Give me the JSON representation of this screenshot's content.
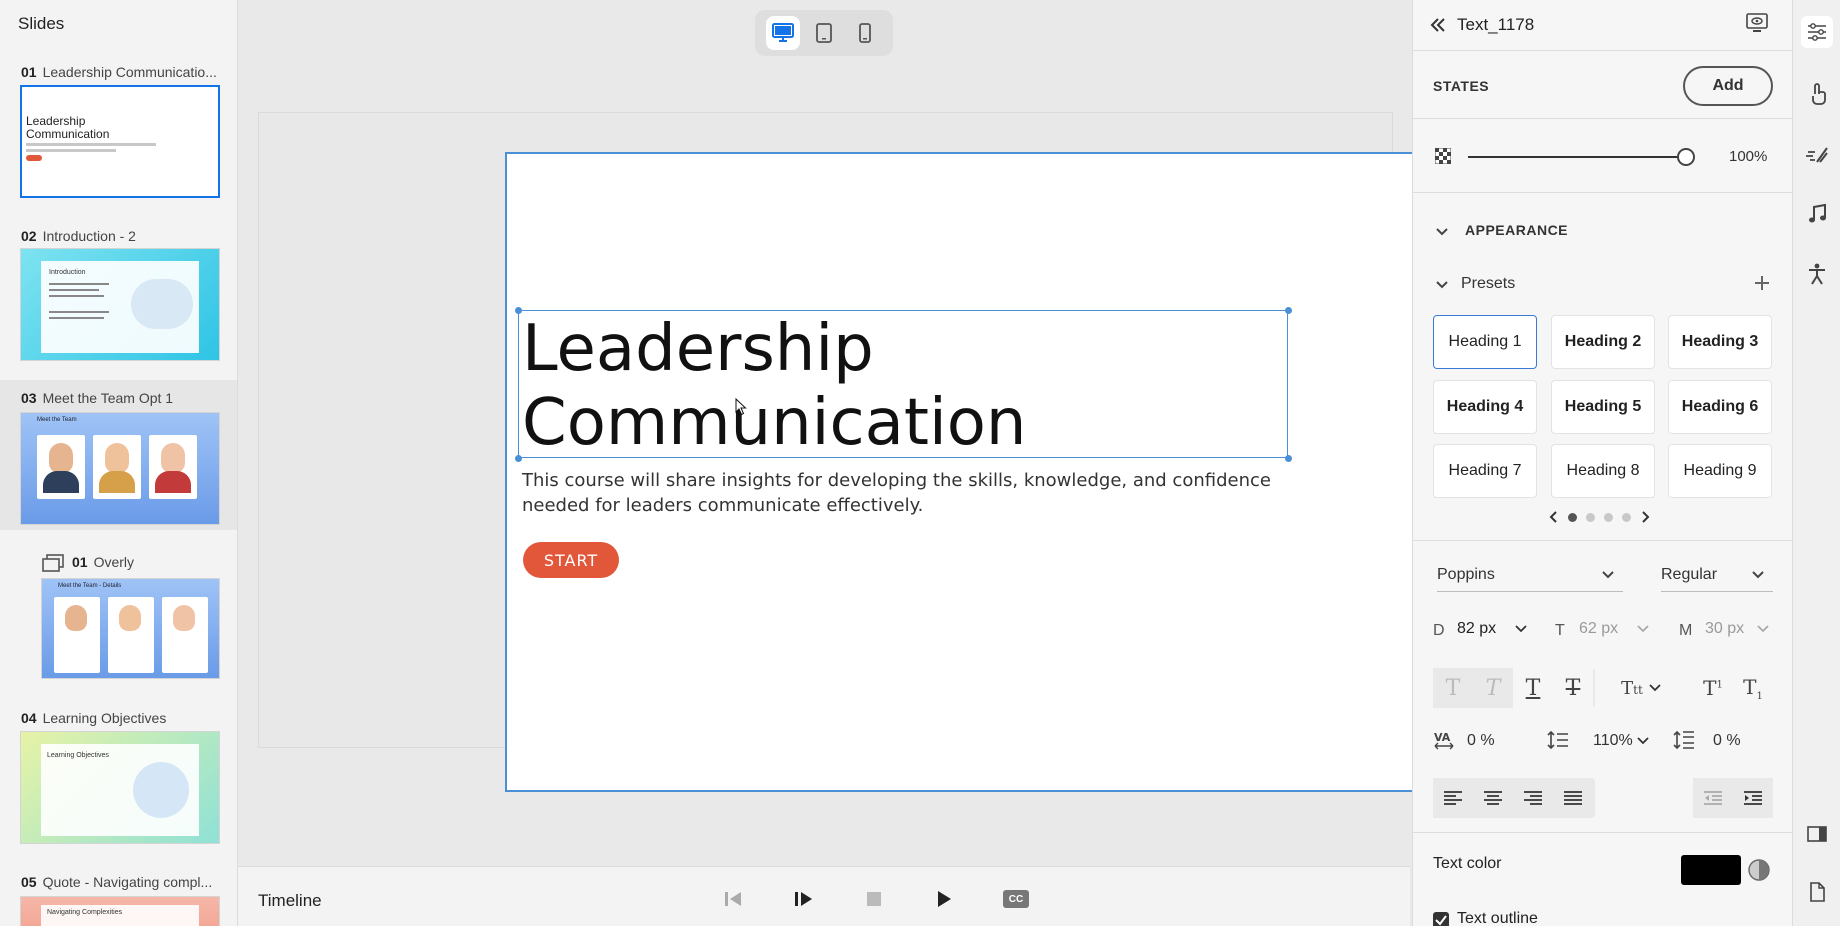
{
  "slides_panel": {
    "title": "Slides",
    "slides": [
      {
        "num": "01",
        "title": "Leadership Communicatio...",
        "thumb_title": "Leadership Communication"
      },
      {
        "num": "02",
        "title": "Introduction - 2",
        "thumb_title": "Introduction"
      },
      {
        "num": "03",
        "title": "Meet the Team Opt 1",
        "thumb_title": "Meet the Team"
      },
      {
        "num": "01",
        "title": "Overly",
        "thumb_title": "Meet the Team - Details"
      },
      {
        "num": "04",
        "title": "Learning Objectives",
        "thumb_title": "Learning Objectives"
      },
      {
        "num": "05",
        "title": "Quote - Navigating compl...",
        "thumb_title": "Navigating Complexities"
      }
    ]
  },
  "device_toggle": {
    "icons": [
      "desktop-icon",
      "tablet-icon",
      "mobile-icon"
    ],
    "active": "desktop"
  },
  "slide": {
    "title": "Leadership\nCommunication",
    "title_line1": "Leadership",
    "title_line2": "Communication",
    "description": "This course will share insights for developing the skills, knowledge, and confidence needed for leaders communicate effectively.",
    "start_label": "START",
    "accent": "#e2573a"
  },
  "timeline": {
    "label": "Timeline",
    "controls": [
      "prev-icon",
      "step-play-icon",
      "stop-icon",
      "play-icon",
      "cc-icon"
    ],
    "cc_label": "CC"
  },
  "properties": {
    "object_name": "Text_1178",
    "states_label": "STATES",
    "add_label": "Add",
    "opacity": "100%",
    "opacity_level": 1.0,
    "appearance_label": "APPEARANCE",
    "presets_label": "Presets",
    "presets": [
      "Heading 1",
      "Heading 2",
      "Heading 3",
      "Heading 4",
      "Heading 5",
      "Heading 6",
      "Heading 7",
      "Heading 8",
      "Heading 9"
    ],
    "font_family": "Poppins",
    "font_weight": "Regular",
    "size_desktop_label": "D",
    "size_desktop": "82 px",
    "size_tablet_label": "T",
    "size_tablet": "62 px",
    "size_mobile_label": "M",
    "size_mobile": "30 px",
    "letter_spacing": "0 %",
    "line_height": "110%",
    "para_spacing": "0 %",
    "text_color_label": "Text color",
    "text_color": "#000000",
    "text_outline_label": "Text outline"
  },
  "colors": {
    "brand": "#1473e6",
    "selection": "#4b8fd6"
  }
}
